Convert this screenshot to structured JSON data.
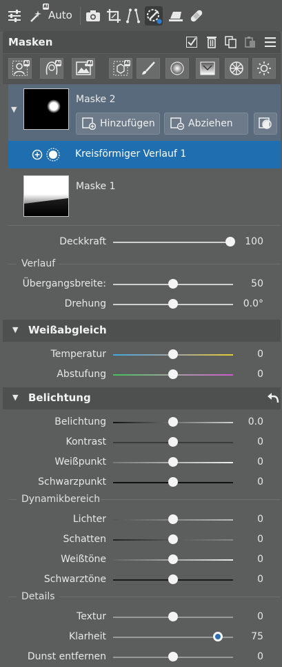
{
  "toolbar": {
    "auto_label": "Auto",
    "icons": [
      "sliders-icon",
      "magic-wand-icon",
      "camera-icon",
      "crop-icon",
      "perspective-icon",
      "mask-brush-icon",
      "eraser-icon",
      "bandage-icon"
    ],
    "ai_badge": "AI"
  },
  "masks_panel": {
    "title": "Masken",
    "masks": [
      {
        "name": "Maske 2",
        "add_label": "Hinzufügen",
        "subtract_label": "Abziehen",
        "sub_item": "Kreisförmiger Verlauf 1"
      },
      {
        "name": "Maske 1"
      }
    ]
  },
  "opacity": {
    "label": "Deckkraft",
    "value": "100",
    "level": 1.0
  },
  "gradient": {
    "group": "Verlauf",
    "width": {
      "label": "Übergangsbreite:",
      "value": "50",
      "level": 0.5
    },
    "rotation": {
      "label": "Drehung",
      "value": "0.0°",
      "level": 0.5
    }
  },
  "white_balance": {
    "title": "Weißabgleich",
    "temperature": {
      "label": "Temperatur",
      "value": "0",
      "level": 0.5
    },
    "tint": {
      "label": "Abstufung",
      "value": "0",
      "level": 0.5
    }
  },
  "exposure": {
    "title": "Belichtung",
    "exposure": {
      "label": "Belichtung",
      "value": "0.0",
      "level": 0.5
    },
    "contrast": {
      "label": "Kontrast",
      "value": "0",
      "level": 0.5
    },
    "whitepoint": {
      "label": "Weißpunkt",
      "value": "0",
      "level": 0.5
    },
    "blackpoint": {
      "label": "Schwarzpunkt",
      "value": "0",
      "level": 0.5
    }
  },
  "dynamic_range": {
    "group": "Dynamikbereich",
    "lights": {
      "label": "Lichter",
      "value": "0",
      "level": 0.5
    },
    "shadows": {
      "label": "Schatten",
      "value": "0",
      "level": 0.5
    },
    "whites": {
      "label": "Weißtöne",
      "value": "0",
      "level": 0.5
    },
    "blacks": {
      "label": "Schwarztöne",
      "value": "0",
      "level": 0.5
    }
  },
  "details": {
    "group": "Details",
    "texture": {
      "label": "Textur",
      "value": "0",
      "level": 0.5
    },
    "clarity": {
      "label": "Klarheit",
      "value": "75",
      "level": 0.875
    },
    "dehaze": {
      "label": "Dunst entfernen",
      "value": "0",
      "level": 0.5
    }
  },
  "colors": {
    "panel_bg": "#5c5d5d",
    "selected_mask_bg": "#596a7d",
    "selected_item_bg": "#1f6fb0",
    "accent": "#1f6fb0"
  }
}
